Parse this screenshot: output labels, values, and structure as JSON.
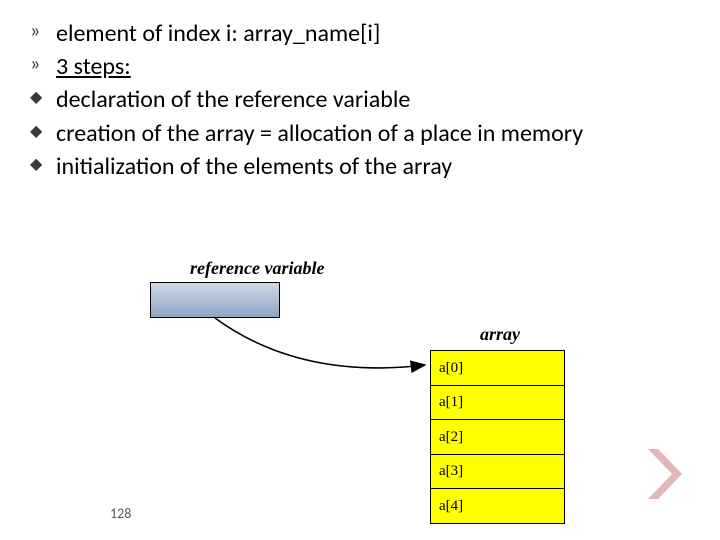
{
  "bullets": {
    "b0": {
      "mark": "»",
      "text_a": "element of index i:   ",
      "text_b": "array_name[i]"
    },
    "b1": {
      "mark": "»",
      "text": "3 steps:"
    },
    "b2": {
      "mark": "◆",
      "text": "declaration of the reference variable"
    },
    "b3": {
      "mark": "◆",
      "text": "creation of the array = allocation of a place in memory"
    },
    "b4": {
      "mark": "◆",
      "text": "initialization of the elements of the array"
    }
  },
  "diagram": {
    "refvar_label": "reference variable",
    "array_label": "array",
    "cells": {
      "c0": "a[0]",
      "c1": "a[1]",
      "c2": "a[2]",
      "c3": "a[3]",
      "c4": "a[4]"
    }
  },
  "pagenum": "128"
}
